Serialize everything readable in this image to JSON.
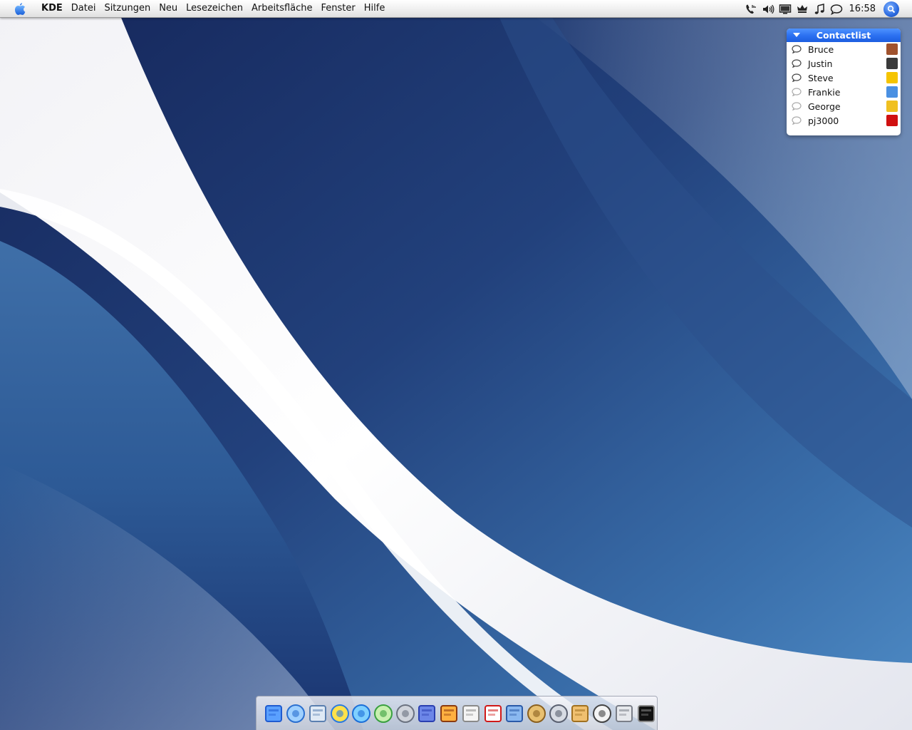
{
  "menubar": {
    "app_name": "KDE",
    "items": [
      "Datei",
      "Sitzungen",
      "Neu",
      "Lesezeichen",
      "Arbeitsfläche",
      "Fenster",
      "Hilfe"
    ],
    "clock": "16:58",
    "tray_icons": [
      "phone-icon",
      "volume-icon",
      "display-icon",
      "crown-icon",
      "music-icon",
      "chat-icon"
    ]
  },
  "contactlist": {
    "title": "Contactlist",
    "contacts": [
      {
        "name": "Bruce",
        "status": "online",
        "avatar_color": "#a0522d"
      },
      {
        "name": "Justin",
        "status": "online",
        "avatar_color": "#3a3a3a"
      },
      {
        "name": "Steve",
        "status": "online",
        "avatar_color": "#f5c400"
      },
      {
        "name": "Frankie",
        "status": "offline",
        "avatar_color": "#4a90e2"
      },
      {
        "name": "George",
        "status": "offline",
        "avatar_color": "#f0c020"
      },
      {
        "name": "pj3000",
        "status": "offline",
        "avatar_color": "#d01010"
      }
    ]
  },
  "dock": {
    "icons": [
      "finder-icon",
      "safari-icon",
      "mail-icon",
      "aim-icon",
      "quicktime-icon",
      "itunes-icon",
      "system-preferences-icon",
      "textedit-icon",
      "iphoto-icon",
      "preview-icon",
      "acrobat-icon",
      "photo-icon",
      "network-icon",
      "internet-connect-icon",
      "address-book-icon",
      "stopwatch-icon",
      "boot-camp-icon",
      "terminal-icon"
    ]
  },
  "colors": {
    "wallpaper_dark": "#1a2d63",
    "wallpaper_mid": "#2e5590",
    "wallpaper_light": "#4a86c0",
    "header_blue": "#2a6ff0"
  }
}
